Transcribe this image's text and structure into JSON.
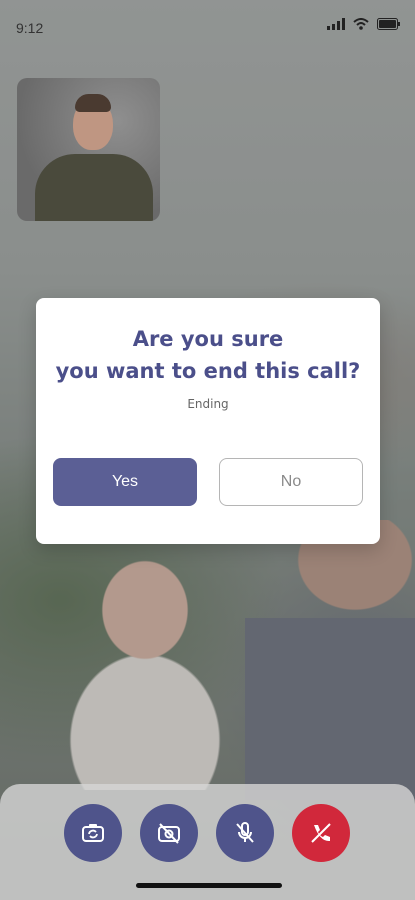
{
  "status_bar": {
    "time": "9:12",
    "icons": [
      "signal-icon",
      "wifi-icon",
      "battery-icon"
    ]
  },
  "dialog": {
    "title_line1": "Are you sure",
    "title_line2": "you want to end this call?",
    "subtitle": "Ending",
    "yes_label": "Yes",
    "no_label": "No"
  },
  "controls": [
    {
      "icon": "switch-camera-icon",
      "color": "#4f548b"
    },
    {
      "icon": "video-off-icon",
      "color": "#4f548b"
    },
    {
      "icon": "mic-off-icon",
      "color": "#4f548b"
    },
    {
      "icon": "end-call-icon",
      "color": "#d1283b"
    }
  ],
  "colors": {
    "accent": "#5b5f95",
    "title": "#4b4f8a",
    "danger": "#d1283b"
  }
}
